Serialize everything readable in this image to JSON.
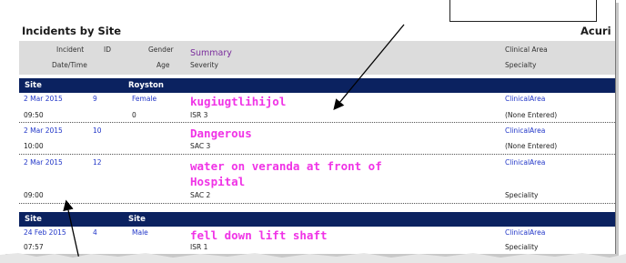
{
  "report": {
    "title": "Incidents by Site",
    "brand": "Acuri"
  },
  "header": {
    "incident": "Incident",
    "id": "ID",
    "gender": "Gender",
    "summary": "Summary",
    "clinical_area": "Clinical Area",
    "datetime": "Date/Time",
    "age": "Age",
    "severity": "Severity",
    "specialty": "Specialty"
  },
  "groups": [
    {
      "site_label": "Site",
      "site_name": "Royston",
      "incidents": [
        {
          "date": "2 Mar 2015",
          "id": "9",
          "gender": "Female",
          "clinical_area": "ClinicalArea",
          "time": "09:50",
          "age": "0",
          "severity": "ISR 3",
          "specialty": "(None Entered)",
          "summary": [
            "kugiugtlihijol"
          ]
        },
        {
          "date": "2 Mar 2015",
          "id": "10",
          "gender": "",
          "clinical_area": "ClinicalArea",
          "time": "10:00",
          "age": "",
          "severity": "SAC 3",
          "specialty": "(None Entered)",
          "summary": [
            "Dangerous"
          ]
        },
        {
          "date": "2 Mar 2015",
          "id": "12",
          "gender": "",
          "clinical_area": "ClinicalArea",
          "time": "09:00",
          "age": "",
          "severity": "SAC 2",
          "specialty": "Speciality",
          "summary": [
            "water on veranda at front of",
            "Hospital"
          ]
        }
      ]
    },
    {
      "site_label": "Site",
      "site_name": "Site",
      "incidents": [
        {
          "date": "24 Feb 2015",
          "id": "4",
          "gender": "Male",
          "clinical_area": "ClinicalArea",
          "time": "07:57",
          "age": "",
          "severity": "ISR 1",
          "specialty": "Speciality",
          "summary": [
            "fell down lift shaft"
          ]
        }
      ]
    }
  ]
}
